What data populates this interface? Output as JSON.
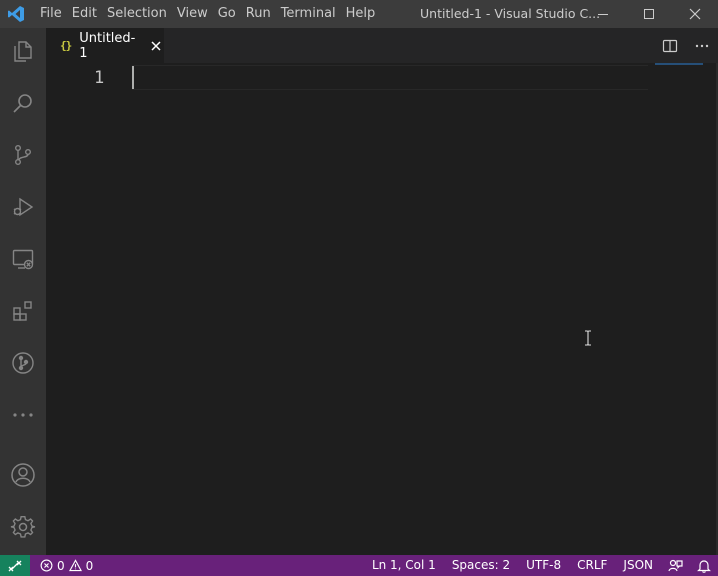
{
  "window": {
    "title": "Untitled-1 - Visual Studio C...",
    "menu": [
      "File",
      "Edit",
      "Selection",
      "View",
      "Go",
      "Run",
      "Terminal",
      "Help"
    ]
  },
  "activity_bar": {
    "items": [
      "explorer-icon",
      "search-icon",
      "source-control-icon",
      "run-debug-icon",
      "remote-explorer-icon",
      "extensions-icon",
      "git-graph-icon",
      "more-icon"
    ],
    "bottom": [
      "accounts-icon",
      "manage-gear-icon"
    ]
  },
  "tab": {
    "icon": "{}",
    "label": "Untitled-1"
  },
  "editor": {
    "line_numbers": [
      "1"
    ]
  },
  "status_bar": {
    "errors": "0",
    "warnings": "0",
    "position": "Ln 1, Col 1",
    "spaces": "Spaces: 2",
    "encoding": "UTF-8",
    "eol": "CRLF",
    "language": "JSON"
  },
  "colors": {
    "status_bar": "#68217a",
    "remote": "#16825d",
    "activity_bar": "#333333",
    "title_bar": "#3c3c3c",
    "editor_bg": "#1e1e1e"
  }
}
